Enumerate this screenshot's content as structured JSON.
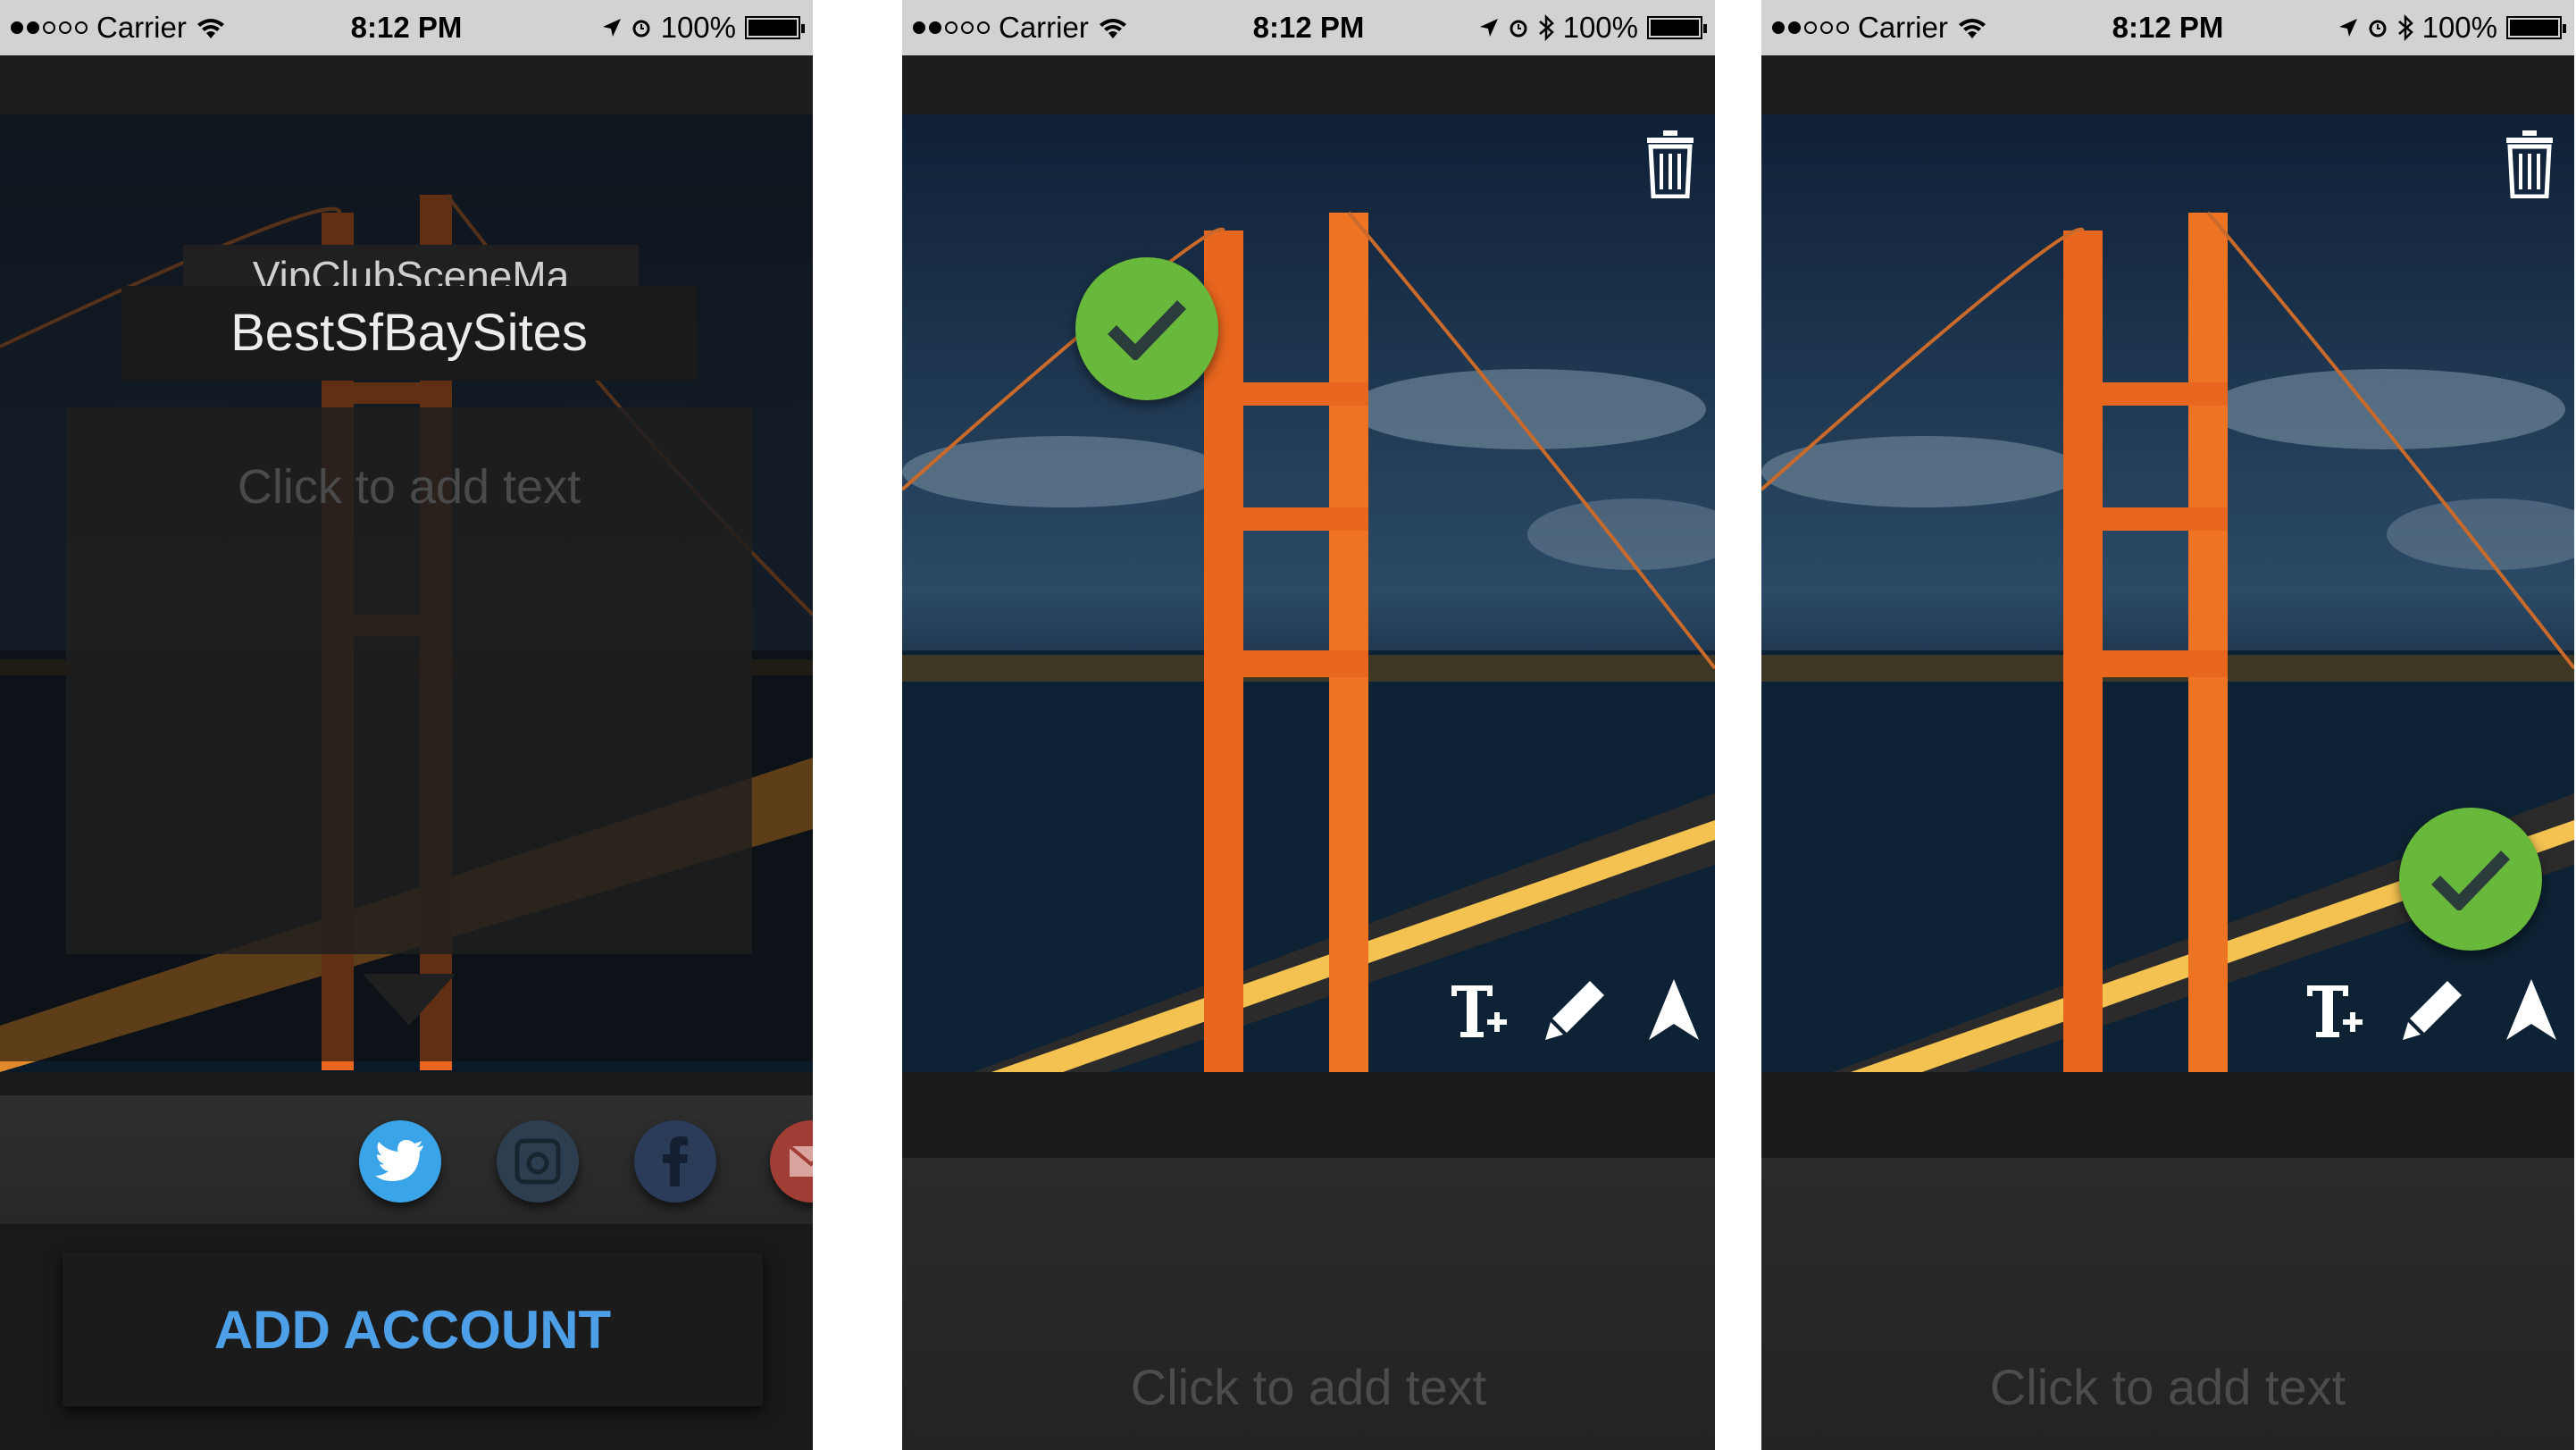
{
  "status_bar": {
    "carrier": "Carrier",
    "time": "8:12 PM",
    "battery": "100%"
  },
  "screen1": {
    "title_back": "VipClubSceneMa",
    "title_front": "BestSfBaySites",
    "text_placeholder": "Click to add text",
    "share_icons": [
      "twitter-icon",
      "instagram-icon",
      "facebook-icon",
      "email-icon"
    ],
    "add_account_label": "ADD ACCOUNT",
    "colors": {
      "twitter": "#3aa4e8",
      "instagram": "#2c3e50",
      "facebook": "#2a3c58",
      "email": "#a03d34",
      "accent": "#4da0e8"
    }
  },
  "screen2": {
    "text_placeholder": "Click to add text",
    "tools": [
      "text-add-icon",
      "pencil-icon",
      "arrow-icon",
      "trash-icon",
      "checkmark-icon"
    ]
  },
  "screen3": {
    "text_placeholder": "Click to add text",
    "tools": [
      "text-add-icon",
      "pencil-icon",
      "arrow-icon",
      "trash-icon",
      "checkmark-icon"
    ]
  },
  "colors": {
    "check_green": "#67b83b",
    "bridge_orange": "#e8661e"
  }
}
